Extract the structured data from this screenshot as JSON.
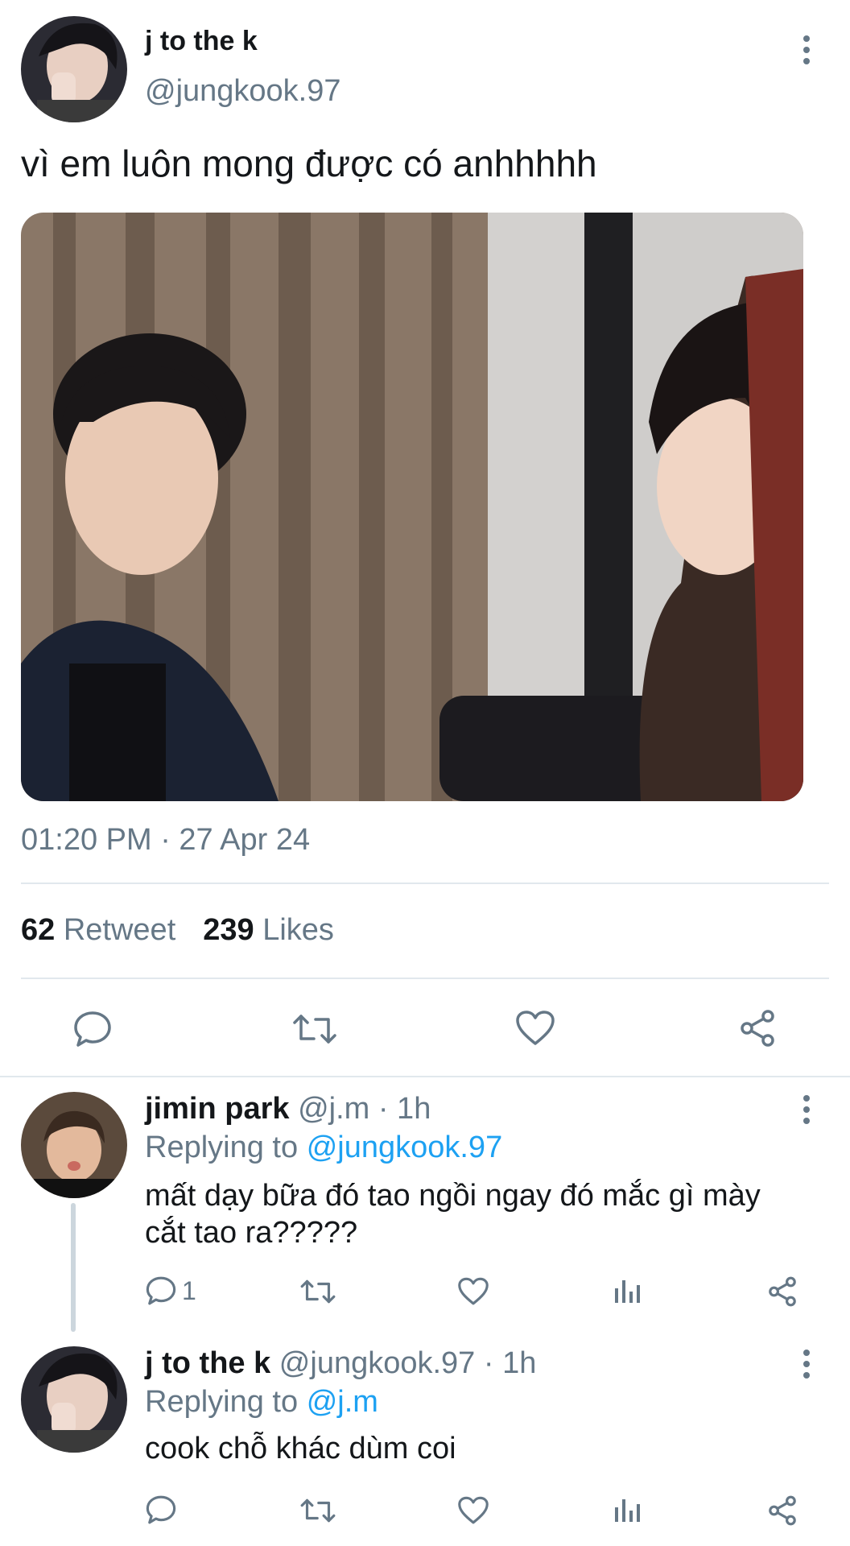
{
  "main_tweet": {
    "display_name": "j to the k",
    "handle": "@jungkook.97",
    "text": "vì em luôn mong được có anhhhhh",
    "timestamp": "01:20 PM · 27 Apr 24",
    "retweet_count": "62",
    "retweet_label": "Retweet",
    "likes_count": "239",
    "likes_label": "Likes"
  },
  "replies": [
    {
      "display_name": "jimin park",
      "handle_time": "@j.m · 1h",
      "replying_prefix": "Replying to",
      "replying_to": "@jungkook.97",
      "text": "mất dạy bữa đó tao ngồi ngay đó mắc gì mày cắt tao ra?????",
      "reply_count": "1"
    },
    {
      "display_name": "j to the k",
      "handle_time": "@jungkook.97 · 1h",
      "replying_prefix": "Replying to",
      "replying_to": "@j.m",
      "text": "cook chỗ khác dùm coi",
      "reply_count": ""
    }
  ],
  "icons": {
    "main_actions": [
      "comment-icon",
      "retweet-icon",
      "heart-icon",
      "share-icon"
    ],
    "reply_actions": [
      "comment-icon",
      "retweet-icon",
      "heart-icon",
      "analytics-icon",
      "share-icon"
    ],
    "menu": "more-vertical-icon"
  },
  "colors": {
    "text": "#14171a",
    "secondary": "#657786",
    "link": "#1da1f2",
    "divider": "#e1e8ed"
  }
}
